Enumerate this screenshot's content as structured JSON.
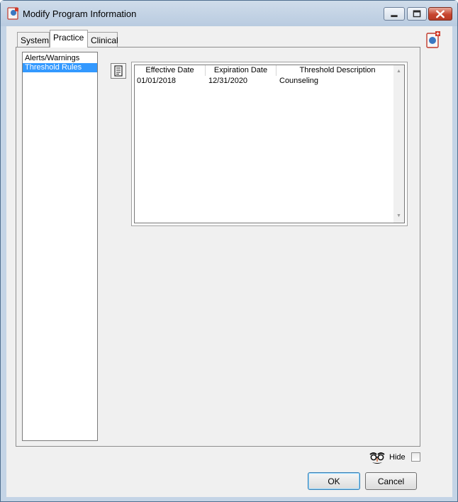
{
  "window": {
    "title": "Modify Program Information",
    "app_icon": "program-info-icon"
  },
  "tabs": [
    {
      "label": "System",
      "active": false
    },
    {
      "label": "Practice",
      "active": true
    },
    {
      "label": "Clinical",
      "active": false
    }
  ],
  "sidebar": {
    "items": [
      {
        "label": "Alerts/Warnings",
        "selected": false
      },
      {
        "label": "Threshold Rules",
        "selected": true
      }
    ]
  },
  "grid": {
    "columns": [
      "Effective Date",
      "Expiration Date",
      "Threshold Description"
    ],
    "rows": [
      {
        "effective": "01/01/2018",
        "expiration": "12/31/2020",
        "description": "Counseling"
      }
    ]
  },
  "footer": {
    "hide_label": "Hide",
    "hide_checked": false,
    "ok_label": "OK",
    "cancel_label": "Cancel"
  },
  "colors": {
    "selection": "#3399ff",
    "title_bar": "#c4d4e6",
    "close_button": "#c7452f"
  }
}
